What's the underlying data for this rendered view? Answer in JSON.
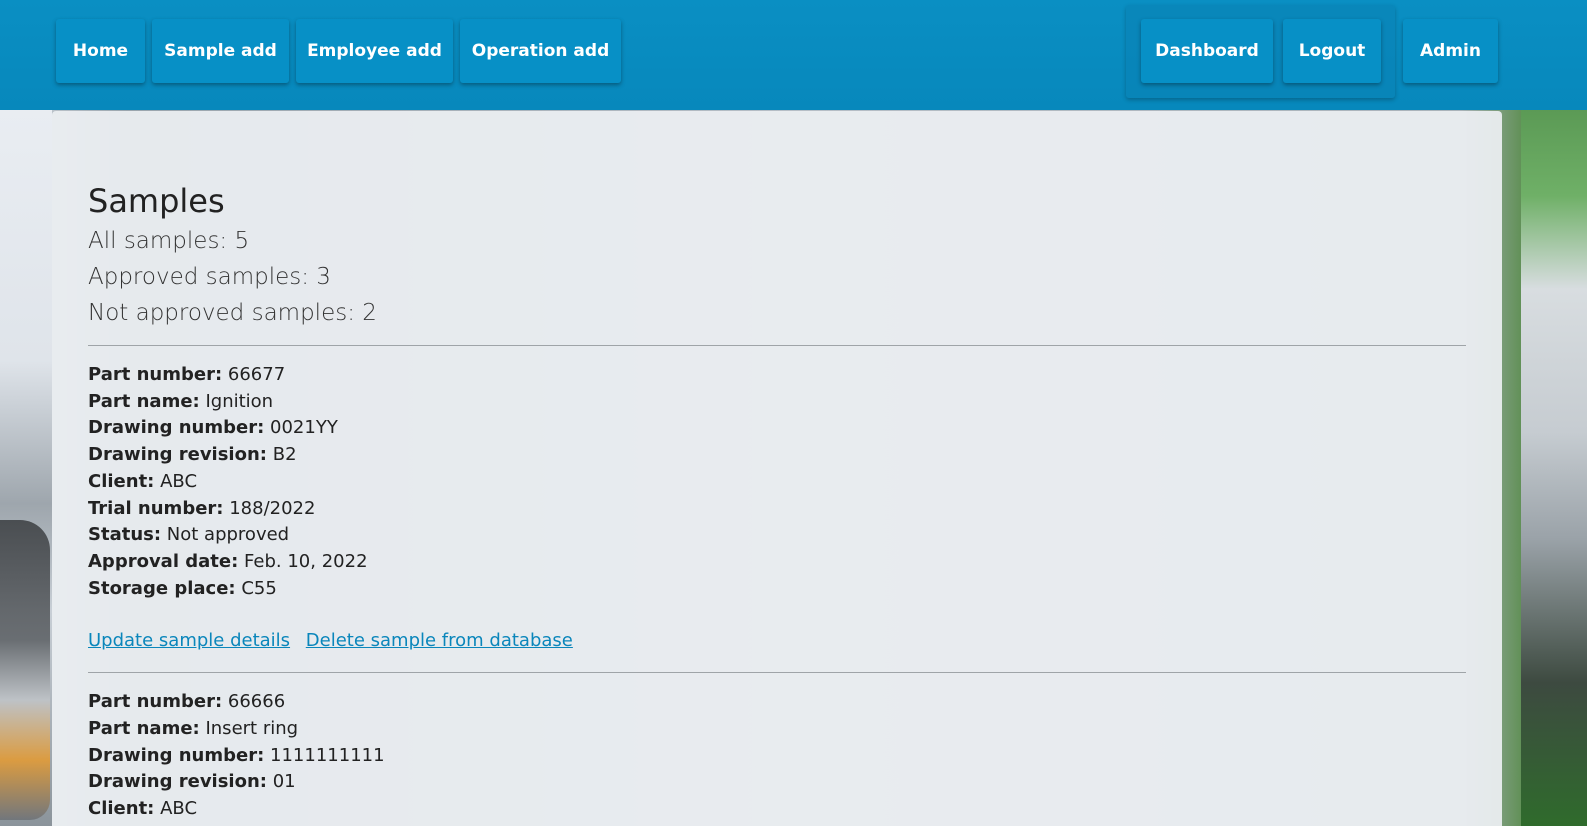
{
  "nav": {
    "left": [
      {
        "label": "Home"
      },
      {
        "label": "Sample add"
      },
      {
        "label": "Employee add"
      },
      {
        "label": "Operation add"
      }
    ],
    "dashboard": "Dashboard",
    "logout": "Logout",
    "admin": "Admin"
  },
  "page": {
    "title": "Samples",
    "all": "All samples: 5",
    "approved": "Approved samples: 3",
    "not_approved": "Not approved samples: 2"
  },
  "labels": {
    "part_number": "Part number:",
    "part_name": "Part name:",
    "drawing_number": "Drawing number:",
    "drawing_revision": "Drawing revision:",
    "client": "Client:",
    "trial_number": "Trial number:",
    "status": "Status:",
    "approval_date": "Approval date:",
    "storage_place": "Storage place:"
  },
  "samples": [
    {
      "part_number": "66677",
      "part_name": "Ignition",
      "drawing_number": "0021YY",
      "drawing_revision": "B2",
      "client": "ABC",
      "trial_number": "188/2022",
      "status": "Not approved",
      "approval_date": "Feb. 10, 2022",
      "storage_place": "C55",
      "update_link": "Update sample details",
      "delete_link": "Delete sample from database"
    },
    {
      "part_number": "66666",
      "part_name": "Insert ring",
      "drawing_number": "1111111111",
      "drawing_revision": "01",
      "client": "ABC"
    }
  ]
}
